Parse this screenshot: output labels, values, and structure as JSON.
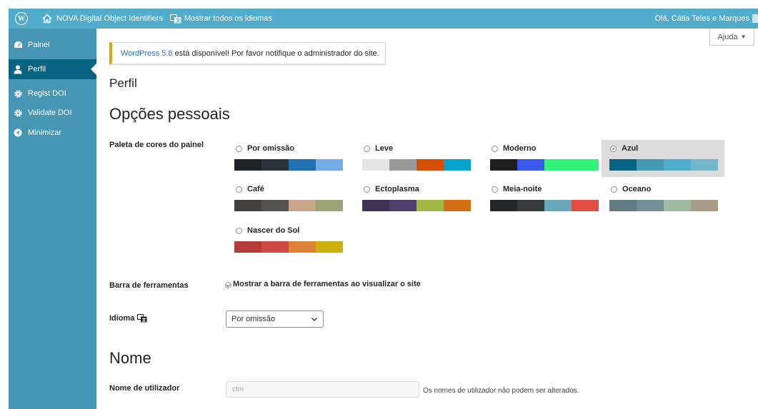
{
  "adminbar": {
    "site_name": "NOVA Digital Object Identifiers",
    "languages_link": "Mostrar todos os idiomas",
    "greeting": "Olá, Cátia Teles e Marques"
  },
  "sidebar": {
    "items": [
      {
        "label": "Painel",
        "icon": "dashboard-icon"
      },
      {
        "label": "Perfil",
        "icon": "user-icon"
      },
      {
        "label": "Regist DOI",
        "icon": "gear-icon"
      },
      {
        "label": "Validate DOI",
        "icon": "gear-icon"
      },
      {
        "label": "Minimizar",
        "icon": "collapse-arrow-icon"
      }
    ]
  },
  "help_button": "Ajuda",
  "notice": {
    "link": "WordPress 5.8",
    "text": "está disponível! Por favor notifique o administrador do site."
  },
  "page_title": "Perfil",
  "section_personal": "Opções pessoais",
  "color_scheme": {
    "label": "Paleta de cores do painel",
    "selected": "Azul",
    "schemes": [
      {
        "name": "Por omissão",
        "colors": [
          "#1d2327",
          "#2c3338",
          "#2271b1",
          "#72aee6"
        ]
      },
      {
        "name": "Leve",
        "colors": [
          "#e5e5e5",
          "#999999",
          "#d64e07",
          "#04a4cc"
        ]
      },
      {
        "name": "Moderno",
        "colors": [
          "#1e1e1e",
          "#3858e9",
          "#33f078",
          "#33f078"
        ]
      },
      {
        "name": "Azul",
        "colors": [
          "#096484",
          "#4796b3",
          "#52accc",
          "#74b6ce"
        ]
      },
      {
        "name": "Café",
        "colors": [
          "#46403c",
          "#59524c",
          "#c7a589",
          "#9ea476"
        ]
      },
      {
        "name": "Ectoplasma",
        "colors": [
          "#413256",
          "#523f6d",
          "#a3b745",
          "#d46f15"
        ]
      },
      {
        "name": "Meia-noite",
        "colors": [
          "#25282b",
          "#363b3f",
          "#69a8bb",
          "#e14d43"
        ]
      },
      {
        "name": "Oceano",
        "colors": [
          "#627c83",
          "#738e96",
          "#9ebaa0",
          "#aa9d88"
        ]
      },
      {
        "name": "Nascer do Sol",
        "colors": [
          "#b43c38",
          "#cf4944",
          "#dd823b",
          "#ccaf0b"
        ]
      }
    ]
  },
  "toolbar": {
    "label": "Barra de ferramentas",
    "checkbox_text": "Mostrar a barra de ferramentas ao visualizar o site",
    "checked": true
  },
  "language": {
    "label": "Idioma",
    "value": "Por omissão"
  },
  "section_name": "Nome",
  "username": {
    "label": "Nome de utilizador",
    "value": "ctm",
    "description": "Os nomes de utilizador não podem ser alterados."
  }
}
